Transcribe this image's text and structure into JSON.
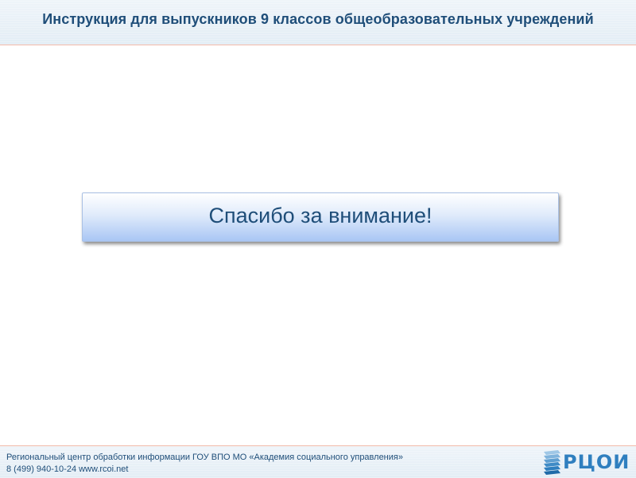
{
  "header": {
    "title": "Инструкция для выпускников 9 классов общеобразовательных учреждений"
  },
  "main": {
    "thanks_text": "Спасибо за внимание!"
  },
  "footer": {
    "organization": "Региональный центр обработки информации ГОУ ВПО МО «Академия социального управления»",
    "contacts": "8 (499) 940-10-24 www.rcoi.net"
  },
  "logo": {
    "text": "РЦОИ",
    "icon": "stacked-sheets-icon"
  },
  "colors": {
    "title_blue": "#1f4e79",
    "logo_blue": "#2f7fbf",
    "divider_salmon": "#f0b8a8",
    "box_gradient_bottom": "#a9c6f4"
  }
}
